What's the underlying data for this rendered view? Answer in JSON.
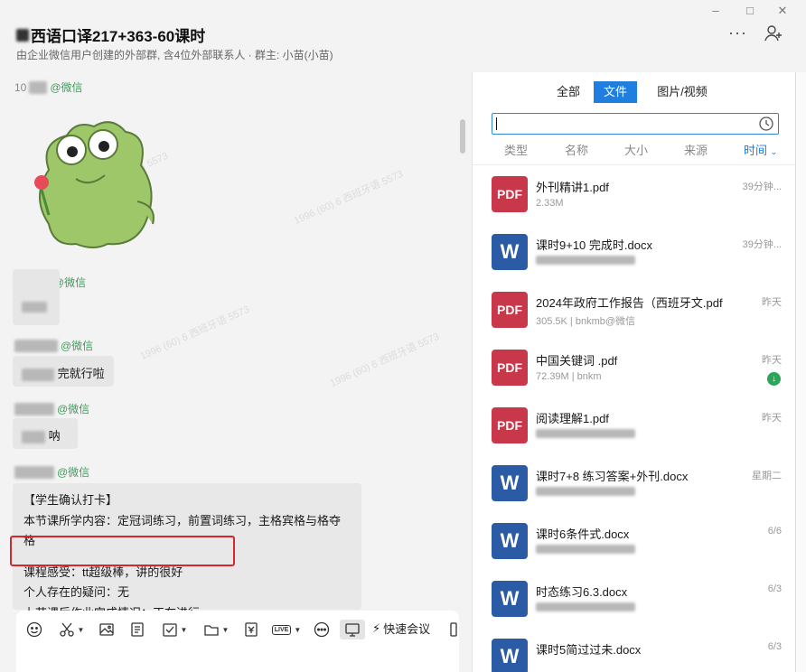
{
  "header": {
    "title": "西语口译217+363-60课时",
    "subtitle": "由企业微信用户创建的外部群, 含4位外部联系人 · 群主: 小苗(小苗)",
    "more_label": "···"
  },
  "chat": {
    "messages": [
      {
        "sender_suffix": "@微信",
        "sender_prefix": "10"
      },
      {
        "sender_suffix": "@微信"
      },
      {
        "sender_suffix": "@微信",
        "text": "完就行啦"
      },
      {
        "sender_suffix": "@微信",
        "text": "呐"
      },
      {
        "sender_suffix": "@微信"
      }
    ],
    "checkin": {
      "line1": "【学生确认打卡】",
      "line2": "本节课所学内容：定冠词练习，前置词练习，主格宾格与格夺格",
      "line3": "课程感受：tt超级棒，讲的很好",
      "line4": "个人存在的疑问：无",
      "line5": "上节课后作业完成情况：正在进行"
    },
    "watermark": "1996 (60) 6 西班牙语 5573"
  },
  "toolbar": {
    "live_label": "LIVE",
    "meeting_label": "快速会议"
  },
  "files_panel": {
    "tabs": [
      "全部",
      "文件",
      "图片/视频"
    ],
    "active_tab": "文件",
    "search_placeholder": "",
    "sort": [
      "类型",
      "名称",
      "大小",
      "来源",
      "时间"
    ],
    "active_sort": "时间",
    "files": [
      {
        "type": "PDF",
        "name": "外刊精讲1.pdf",
        "meta": "2.33M",
        "time": "39分钟..."
      },
      {
        "type": "W",
        "name": "课时9+10 完成时.docx",
        "meta": "",
        "time": "39分钟..."
      },
      {
        "type": "PDF",
        "name": "2024年政府工作报告（西班牙文.pdf",
        "meta": "305.5K | bnkmb@微信",
        "time": "昨天"
      },
      {
        "type": "PDF",
        "name": "中国关键词 .pdf",
        "meta": "72.39M | bnkm",
        "time": "昨天",
        "downloaded": true
      },
      {
        "type": "PDF",
        "name": "阅读理解1.pdf",
        "meta": "",
        "time": "昨天"
      },
      {
        "type": "W",
        "name": "课时7+8 练习答案+外刊.docx",
        "meta": "",
        "time": "星期二"
      },
      {
        "type": "W",
        "name": "课时6条件式.docx",
        "meta": "",
        "time": "6/6"
      },
      {
        "type": "W",
        "name": "时态练习6.3.docx",
        "meta": "",
        "time": "6/3"
      },
      {
        "type": "W",
        "name": "课时5简过过未.docx",
        "meta": "",
        "time": "6/3"
      }
    ]
  },
  "colors": {
    "accent": "#1f7ee0",
    "pdf": "#c9374a",
    "word": "#2c5ba6",
    "highlight_box": "#d9262c",
    "wechat_green": "#3aa05a"
  }
}
